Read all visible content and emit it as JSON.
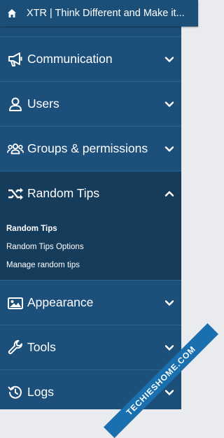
{
  "header": {
    "title": "XTR | Think Different and Make it...",
    "home_icon": "home-icon"
  },
  "sidebar": {
    "items": [
      {
        "label": "Communication",
        "icon": "megaphone-icon",
        "expanded": false
      },
      {
        "label": "Users",
        "icon": "user-icon",
        "expanded": false
      },
      {
        "label": "Groups & permissions",
        "icon": "users-group-icon",
        "expanded": false
      },
      {
        "label": "Random Tips",
        "icon": "shuffle-icon",
        "expanded": true
      },
      {
        "label": "Appearance",
        "icon": "image-icon",
        "expanded": false
      },
      {
        "label": "Tools",
        "icon": "wrench-icon",
        "expanded": false
      },
      {
        "label": "Logs",
        "icon": "history-icon",
        "expanded": false
      }
    ],
    "random_tips_submenu": [
      {
        "label": "Random Tips",
        "active": true
      },
      {
        "label": "Random Tips Options",
        "active": false
      },
      {
        "label": "Manage random tips",
        "active": false
      }
    ]
  },
  "watermark": {
    "text": "TECHIESHOME.COM"
  },
  "colors": {
    "header_bg": "#1b4f78",
    "sidebar_bg": "#1d4f7b",
    "expanded_bg": "#163c5c",
    "text": "#ffffff"
  }
}
